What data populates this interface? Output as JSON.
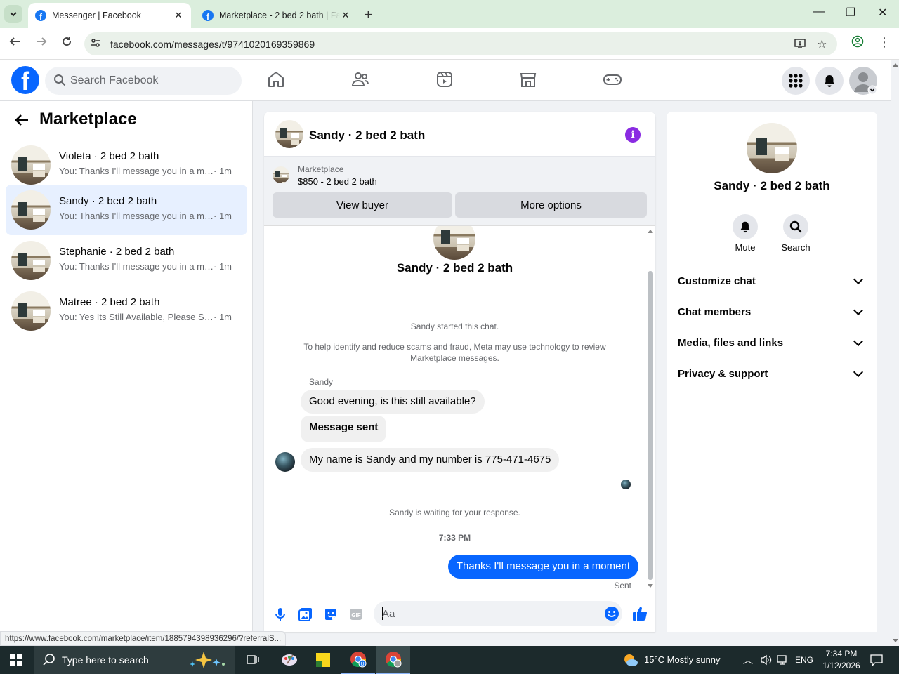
{
  "browser": {
    "tabs": [
      {
        "title": "Messenger | Facebook",
        "active": true
      },
      {
        "title": "Marketplace - 2 bed 2 bath | Fa",
        "active": false
      }
    ],
    "url": "facebook.com/messages/t/9741020169359869",
    "status_url": "https://www.facebook.com/marketplace/item/1885794398936296/?referralS..."
  },
  "fb": {
    "search_placeholder": "Search Facebook"
  },
  "sidebar": {
    "title": "Marketplace",
    "conversations": [
      {
        "name": "Violeta · 2 bed 2 bath",
        "preview": "You: Thanks I'll message you in a mo...",
        "time": "· 1m",
        "selected": false
      },
      {
        "name": "Sandy · 2 bed 2 bath",
        "preview": "You: Thanks I'll message you in a mo...",
        "time": "· 1m",
        "selected": true
      },
      {
        "name": "Stephanie · 2 bed 2 bath",
        "preview": "You: Thanks I'll message you in a mo...",
        "time": "· 1m",
        "selected": false
      },
      {
        "name": "Matree · 2 bed 2 bath",
        "preview": "You: Yes Its Still Available, Please Sen...",
        "time": "· 1m",
        "selected": false
      }
    ]
  },
  "chat": {
    "title": "Sandy · 2 bed 2 bath",
    "listing": {
      "label": "Marketplace",
      "title": "$850 - 2 bed 2 bath",
      "view_buyer": "View buyer",
      "more_options": "More options"
    },
    "center_name": "Sandy · 2 bed 2 bath",
    "started": "Sandy started this chat.",
    "scam_notice": "To help identify and reduce scams and fraud, Meta may use technology to review Marketplace messages.",
    "sender": "Sandy",
    "incoming": [
      "Good evening, is this still available?",
      "Message sent",
      "My name is Sandy and my number is 775-471-4675"
    ],
    "waiting": "Sandy is waiting for your response.",
    "timestamp": "7:33 PM",
    "outgoing": "Thanks I'll message you in a moment",
    "sent_label": "Sent",
    "composer_placeholder": "Aa"
  },
  "info": {
    "name": "Sandy · 2 bed 2 bath",
    "actions": [
      {
        "label": "Mute",
        "icon": "bell-icon"
      },
      {
        "label": "Search",
        "icon": "search-icon"
      }
    ],
    "sections": [
      "Customize chat",
      "Chat members",
      "Media, files and links",
      "Privacy & support"
    ]
  },
  "taskbar": {
    "search_placeholder": "Type here to search",
    "weather": "15°C  Mostly sunny",
    "lang": "ENG",
    "time": "7:34 PM",
    "date": "1/12/2026"
  },
  "colors": {
    "fb_blue": "#0866ff",
    "selected_row": "#e7f0ff",
    "info_purple": "#8a2be2"
  }
}
